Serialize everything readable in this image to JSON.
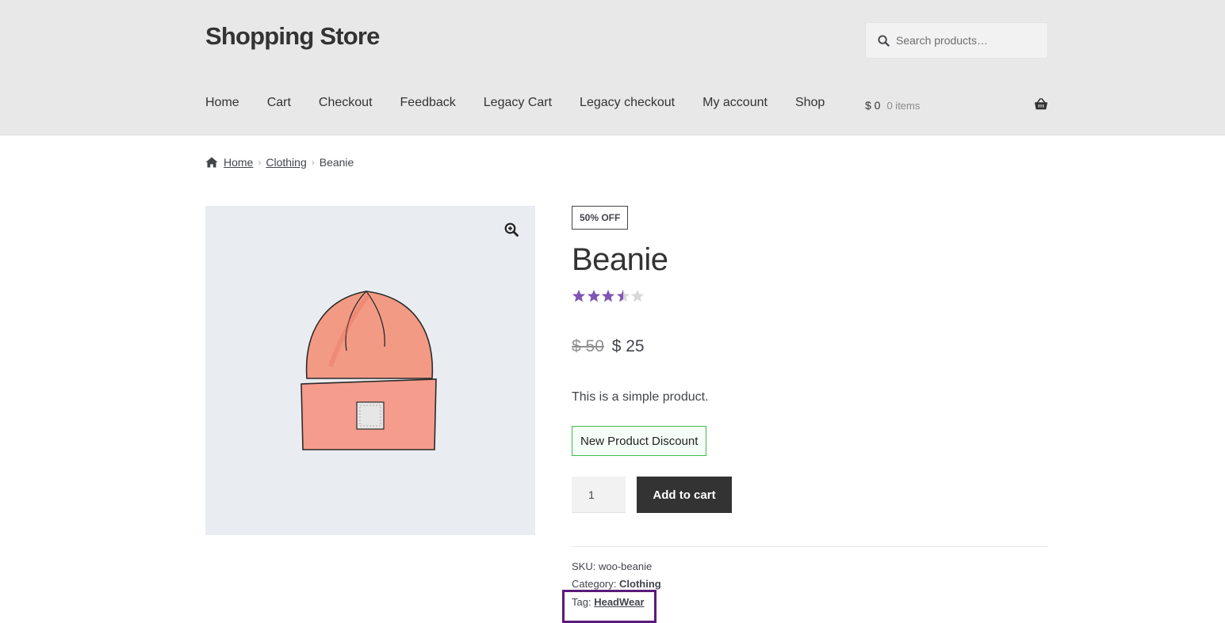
{
  "site": {
    "title": "Shopping Store"
  },
  "search": {
    "placeholder": "Search products…"
  },
  "nav": {
    "items": [
      "Home",
      "Cart",
      "Checkout",
      "Feedback",
      "Legacy Cart",
      "Legacy checkout",
      "My account",
      "Shop"
    ]
  },
  "cart": {
    "amount": "$ 0",
    "count": "0 items"
  },
  "breadcrumb": {
    "home": "Home",
    "category": "Clothing",
    "current": "Beanie",
    "separator": "›"
  },
  "product": {
    "sale_badge": "50% OFF",
    "title": "Beanie",
    "rating": 3.5,
    "rating_max": 5,
    "old_price": "$ 50",
    "price": "$ 25",
    "short_description": "This is a simple product.",
    "discount_label": "New Product Discount",
    "quantity": "1",
    "add_to_cart_label": "Add to cart"
  },
  "meta": {
    "sku_label": "SKU:",
    "sku_value": "woo-beanie",
    "category_label": "Category:",
    "category_value": "Clothing",
    "tag_label": "Tag:",
    "tag_value": "HeadWear"
  },
  "colors": {
    "accent_star": "#7f54b3",
    "empty_star": "#d8d8d8",
    "highlight": "#5a1b7a",
    "discount_border": "#3dbb4c",
    "button_dark": "#333333"
  }
}
